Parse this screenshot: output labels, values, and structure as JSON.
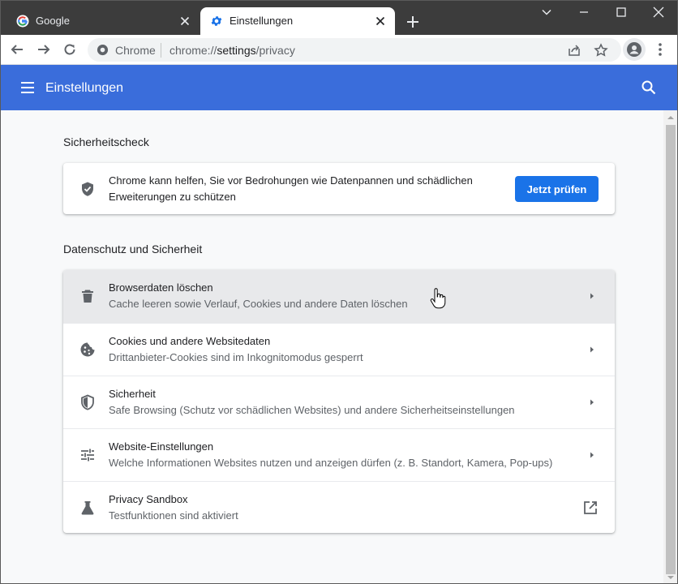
{
  "tabs": [
    {
      "label": "Google",
      "favicon": "google-g-icon",
      "active": false
    },
    {
      "label": "Einstellungen",
      "favicon": "settings-gear-icon",
      "active": true
    }
  ],
  "toolbar": {
    "omnibox_site": "Chrome",
    "url_scheme": "chrome://",
    "url_host": "settings",
    "url_path": "/privacy"
  },
  "appbar": {
    "title": "Einstellungen",
    "color": "#3a6ddb"
  },
  "safety_check": {
    "section_title": "Sicherheitscheck",
    "text": "Chrome kann helfen, Sie vor Bedrohungen wie Datenpannen und schädlichen Erweiterungen zu schützen",
    "button_label": "Jetzt prüfen",
    "icon": "shield-check-icon"
  },
  "privacy": {
    "section_title": "Datenschutz und Sicherheit",
    "items": [
      {
        "title": "Browserdaten löschen",
        "subtitle": "Cache leeren sowie Verlauf, Cookies und andere Daten löschen",
        "icon": "trash-icon",
        "action": "arrow"
      },
      {
        "title": "Cookies und andere Websitedaten",
        "subtitle": "Drittanbieter-Cookies sind im Inkognitomodus gesperrt",
        "icon": "cookie-icon",
        "action": "arrow"
      },
      {
        "title": "Sicherheit",
        "subtitle": "Safe Browsing (Schutz vor schädlichen Websites) und andere Sicherheitseinstellungen",
        "icon": "shield-icon",
        "action": "arrow"
      },
      {
        "title": "Website-Einstellungen",
        "subtitle": "Welche Informationen Websites nutzen und anzeigen dürfen (z. B. Standort, Kamera, Pop-ups)",
        "icon": "tune-icon",
        "action": "arrow"
      },
      {
        "title": "Privacy Sandbox",
        "subtitle": "Testfunktionen sind aktiviert",
        "icon": "flask-icon",
        "action": "external-link"
      }
    ]
  },
  "colors": {
    "accent": "#1a73e8",
    "titlebar": "#3c3c3c",
    "hover_row": "#e8e9eb"
  }
}
